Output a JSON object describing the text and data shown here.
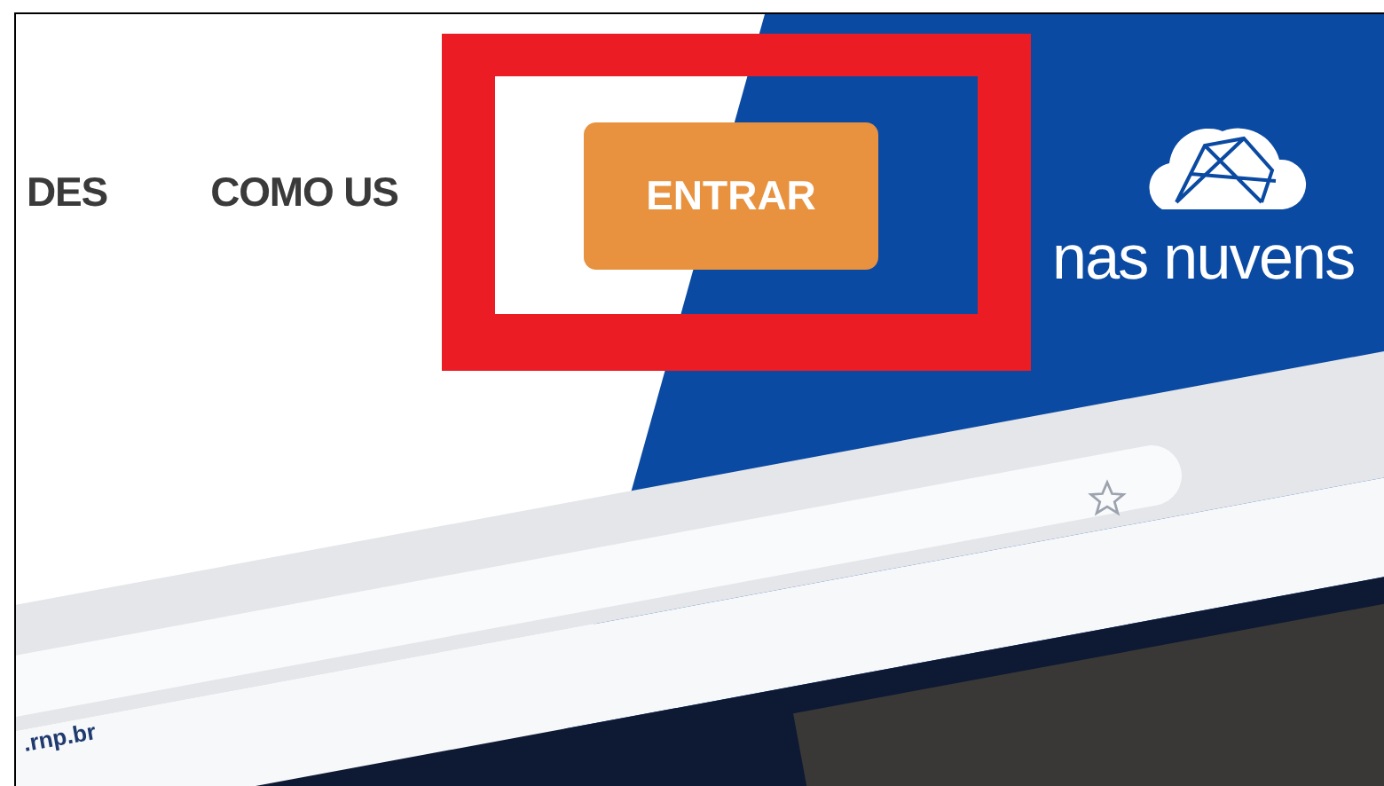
{
  "nav": {
    "items": [
      {
        "label": "DES"
      },
      {
        "label": "COMO US"
      }
    ],
    "login_button": "ENTRAR"
  },
  "logo": {
    "text": "nas nuvens"
  },
  "mockup": {
    "address": ".rnp.br"
  },
  "highlight": {
    "color": "#ec1c24"
  }
}
